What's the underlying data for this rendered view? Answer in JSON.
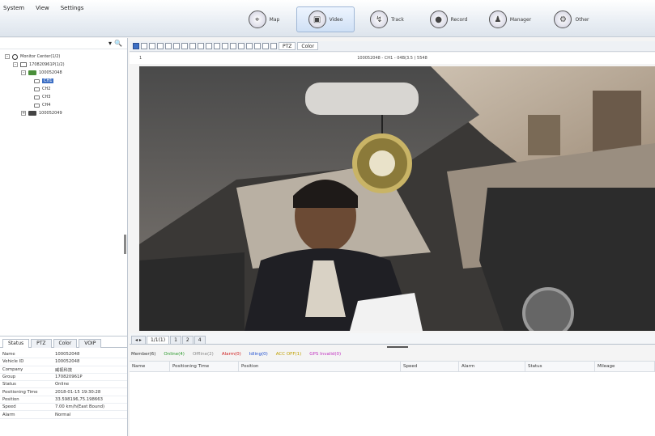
{
  "menu": [
    "System",
    "View",
    "Settings"
  ],
  "nav": [
    {
      "label": "Map",
      "icon": "map-icon"
    },
    {
      "label": "Video",
      "icon": "video-icon",
      "active": true
    },
    {
      "label": "Track",
      "icon": "track-icon"
    },
    {
      "label": "Record",
      "icon": "record-icon"
    },
    {
      "label": "Manager",
      "icon": "manager-icon"
    },
    {
      "label": "Other",
      "icon": "other-icon"
    }
  ],
  "tree": {
    "root": "Monitor Center(1/2)",
    "group": "170820961P(1/2)",
    "device1": "100052048",
    "channels": [
      "CH1",
      "CH2",
      "CH3",
      "CH4"
    ],
    "device2": "100052049"
  },
  "video_toolbar": {
    "ptz": "PTZ",
    "color": "Color"
  },
  "video": {
    "index": "1",
    "title": "100052048 - CH1 - 04B(3.5 ) 5548"
  },
  "channel_tabs": [
    "1/1(1)",
    "1",
    "2",
    "4"
  ],
  "legend": [
    {
      "label": "Member(6)",
      "color": "#333333"
    },
    {
      "label": "Online(4)",
      "color": "#2a9a2a"
    },
    {
      "label": "Offline(2)",
      "color": "#888888"
    },
    {
      "label": "Alarm(0)",
      "color": "#d02020"
    },
    {
      "label": "Idling(0)",
      "color": "#2050d0"
    },
    {
      "label": "ACC OFF(1)",
      "color": "#c0a000"
    },
    {
      "label": "GPS Invalid(0)",
      "color": "#c030c0"
    }
  ],
  "table_columns": [
    "Name",
    "Positioning Time",
    "Position",
    "Speed",
    "Alarm",
    "Status",
    "Mileage"
  ],
  "info_tabs": [
    "Status",
    "PTZ",
    "Color",
    "VOIP"
  ],
  "info": [
    {
      "k": "Name",
      "v": "100052048"
    },
    {
      "k": "Vehicle ID",
      "v": "100052048"
    },
    {
      "k": "Company",
      "v": "威视科技"
    },
    {
      "k": "Group",
      "v": "170820961P"
    },
    {
      "k": "Status",
      "v": "Online"
    },
    {
      "k": "Positioning Time",
      "v": "2018-01-15 19:30:28"
    },
    {
      "k": "Position",
      "v": "33.598196,75.198663"
    },
    {
      "k": "Speed",
      "v": "7.00 km/h(East Bound)"
    },
    {
      "k": "Alarm",
      "v": "Normal"
    }
  ]
}
